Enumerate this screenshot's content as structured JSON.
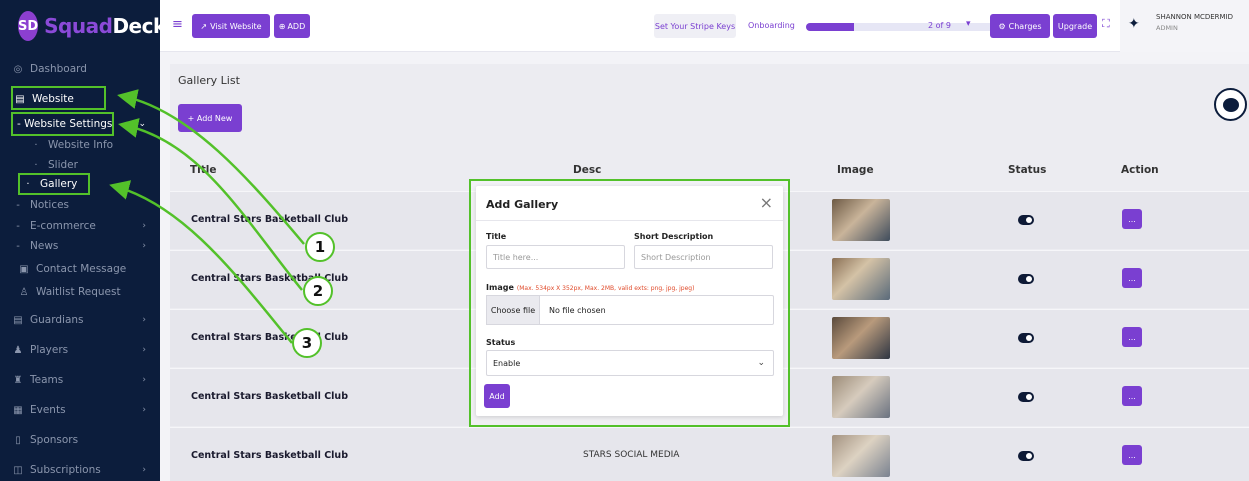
{
  "brand": {
    "logo_mark": "SD",
    "name_part1": "Squad",
    "name_part2": "Deck"
  },
  "sidebar": {
    "items": [
      {
        "label": "Dashboard",
        "icon": "gauge-icon"
      },
      {
        "label": "Website",
        "icon": "layout-icon"
      },
      {
        "label": "- Website Settings",
        "icon": ""
      },
      {
        "label": "Website Info",
        "icon": "dot-icon"
      },
      {
        "label": "Slider",
        "icon": "dot-icon"
      },
      {
        "label": "Gallery",
        "icon": "dot-icon"
      },
      {
        "label": "Notices",
        "icon": "dash-icon"
      },
      {
        "label": "E-commerce",
        "icon": "dash-icon"
      },
      {
        "label": "News",
        "icon": "dash-icon"
      },
      {
        "label": "Contact Message",
        "icon": "message-icon"
      },
      {
        "label": "Waitlist Request",
        "icon": "user-icon"
      },
      {
        "label": "Guardians",
        "icon": "guardian-icon"
      },
      {
        "label": "Players",
        "icon": "player-icon"
      },
      {
        "label": "Teams",
        "icon": "team-icon"
      },
      {
        "label": "Events",
        "icon": "calendar-icon"
      },
      {
        "label": "Sponsors",
        "icon": "sponsor-icon"
      },
      {
        "label": "Subscriptions",
        "icon": "subscription-icon"
      }
    ]
  },
  "header": {
    "visit_website": "Visit Website",
    "add": "ADD",
    "stripe_keys": "Set Your Stripe Keys",
    "onboarding": "Onboarding",
    "onboarding_progress": 0.25,
    "step": "2 of 9",
    "charges": "Charges",
    "upgrade": "Upgrade",
    "user_name": "SHANNON MCDERMID",
    "user_role": "ADMIN"
  },
  "page": {
    "title": "Gallery List",
    "add_new": "+ Add New",
    "columns": [
      "Title",
      "Desc",
      "Image",
      "Status",
      "Action"
    ],
    "rows": [
      {
        "title": "Central Stars Basketball Club",
        "desc": ""
      },
      {
        "title": "Central Stars Basketball Club",
        "desc": ""
      },
      {
        "title": "Central Stars Basketball Club",
        "desc": ""
      },
      {
        "title": "Central Stars Basketball Club",
        "desc": ""
      },
      {
        "title": "Central Stars Basketball Club",
        "desc": "STARS SOCIAL MEDIA"
      }
    ],
    "action_label": "..."
  },
  "modal": {
    "title": "Add Gallery",
    "close": "×",
    "title_label": "Title",
    "title_placeholder": "Title here...",
    "short_desc_label": "Short Description",
    "short_desc_placeholder": "Short Description",
    "image_label": "Image",
    "image_hint": "(Max. 534px X 352px, Max. 2MB, valid exts: png, jpg, jpeg)",
    "choose_file": "Choose file",
    "no_file": "No file chosen",
    "status_label": "Status",
    "status_value": "Enable",
    "add_button": "Add"
  },
  "annotations": [
    "1",
    "2",
    "3"
  ],
  "colors": {
    "sidebar": "#0c1d3c",
    "accent": "#7a3fd1",
    "highlight": "#53c12a"
  }
}
